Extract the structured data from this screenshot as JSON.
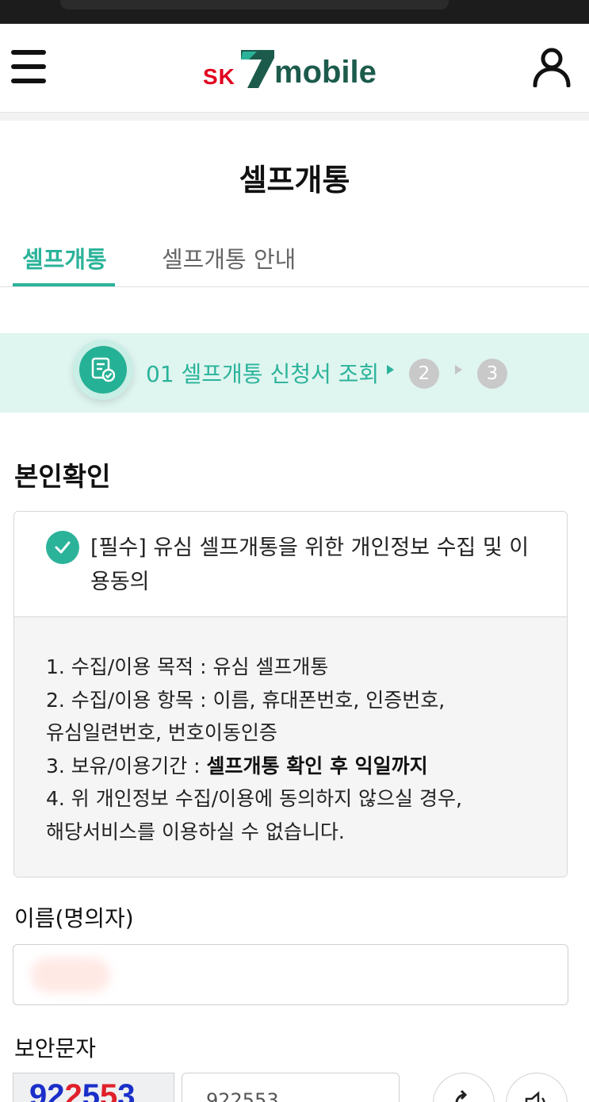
{
  "header": {
    "logo": {
      "sk": "SK",
      "mobile": "mobile",
      "colors": {
        "sk": "#e1001e",
        "brand": "#1c5b4c"
      }
    }
  },
  "page": {
    "title": "셀프개통"
  },
  "tabs": [
    {
      "label": "셀프개통",
      "active": true
    },
    {
      "label": "셀프개통 안내",
      "active": false
    }
  ],
  "steps": {
    "current_label": "01 셀프개통 신청서 조회",
    "next": [
      "2",
      "3"
    ]
  },
  "identity": {
    "section_title": "본인확인",
    "consent": {
      "checked": true,
      "title": "[필수] 유심 셀프개통을 위한 개인정보 수집 및 이용동의",
      "terms": {
        "line1": "1. 수집/이용 목적 : 유심 셀프개통",
        "line2a": "2. 수집/이용 항목 : 이름, 휴대폰번호, 인증번호,",
        "line2b": "유심일련번호, 번호이동인증",
        "line3_prefix": "3. 보유/이용기간 : ",
        "line3_bold": "셀프개통 확인 후 익일까지",
        "line4a": "4. 위 개인정보 수집/이용에 동의하지 않으실 경우,",
        "line4b": "해당서비스를 이용하실 수 없습니다."
      }
    }
  },
  "form": {
    "name_label": "이름(명의자)",
    "captcha_label": "보안문자",
    "captcha_image_text": "922553",
    "captcha_input_value": "922553"
  },
  "colors": {
    "accent": "#2bb39a",
    "step_bg": "#dff5f0"
  }
}
